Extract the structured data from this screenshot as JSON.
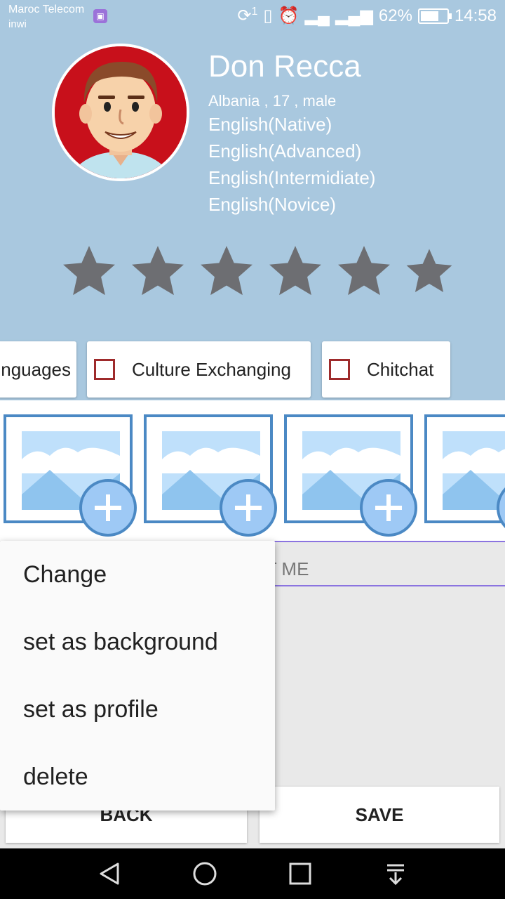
{
  "status_bar": {
    "carrier_primary": "Maroc Telecom",
    "carrier_secondary": "inwi",
    "sim_badge": "1",
    "battery_percent": "62%",
    "time": "14:58",
    "icons": [
      "image-notification-icon",
      "sync-icon",
      "vibrate-icon",
      "alarm-icon",
      "signal-h-plus-icon",
      "signal-icon",
      "battery-icon"
    ]
  },
  "profile": {
    "name": "Don Recca",
    "meta": "Albania , 17 , male",
    "languages": [
      "English(Native)",
      "English(Advanced)",
      "English(Intermidiate)",
      "English(Novice)"
    ],
    "rating": {
      "total_stars": 6
    }
  },
  "interests": [
    {
      "label": "nguages",
      "checked": false
    },
    {
      "label": "Culture Exchanging",
      "checked": false
    },
    {
      "label": "Chitchat",
      "checked": false
    }
  ],
  "gallery": {
    "count_visible": 4
  },
  "about_me": {
    "placeholder": "UT ME"
  },
  "buttons": {
    "back": "BACK",
    "save": "SAVE"
  },
  "context_menu": {
    "items": [
      "Change",
      "set as background",
      "set as profile",
      "delete"
    ]
  },
  "colors": {
    "header_bg": "#a9c8df",
    "star": "#6d6e72",
    "photo_border": "#4b89c4",
    "checkbox": "#9e2a2b",
    "accent_line": "#8b74e0",
    "avatar_bg": "#c8101b"
  },
  "navbar": {
    "icons": [
      "back-nav-icon",
      "home-nav-icon",
      "recents-nav-icon",
      "notifications-pull-icon"
    ]
  }
}
